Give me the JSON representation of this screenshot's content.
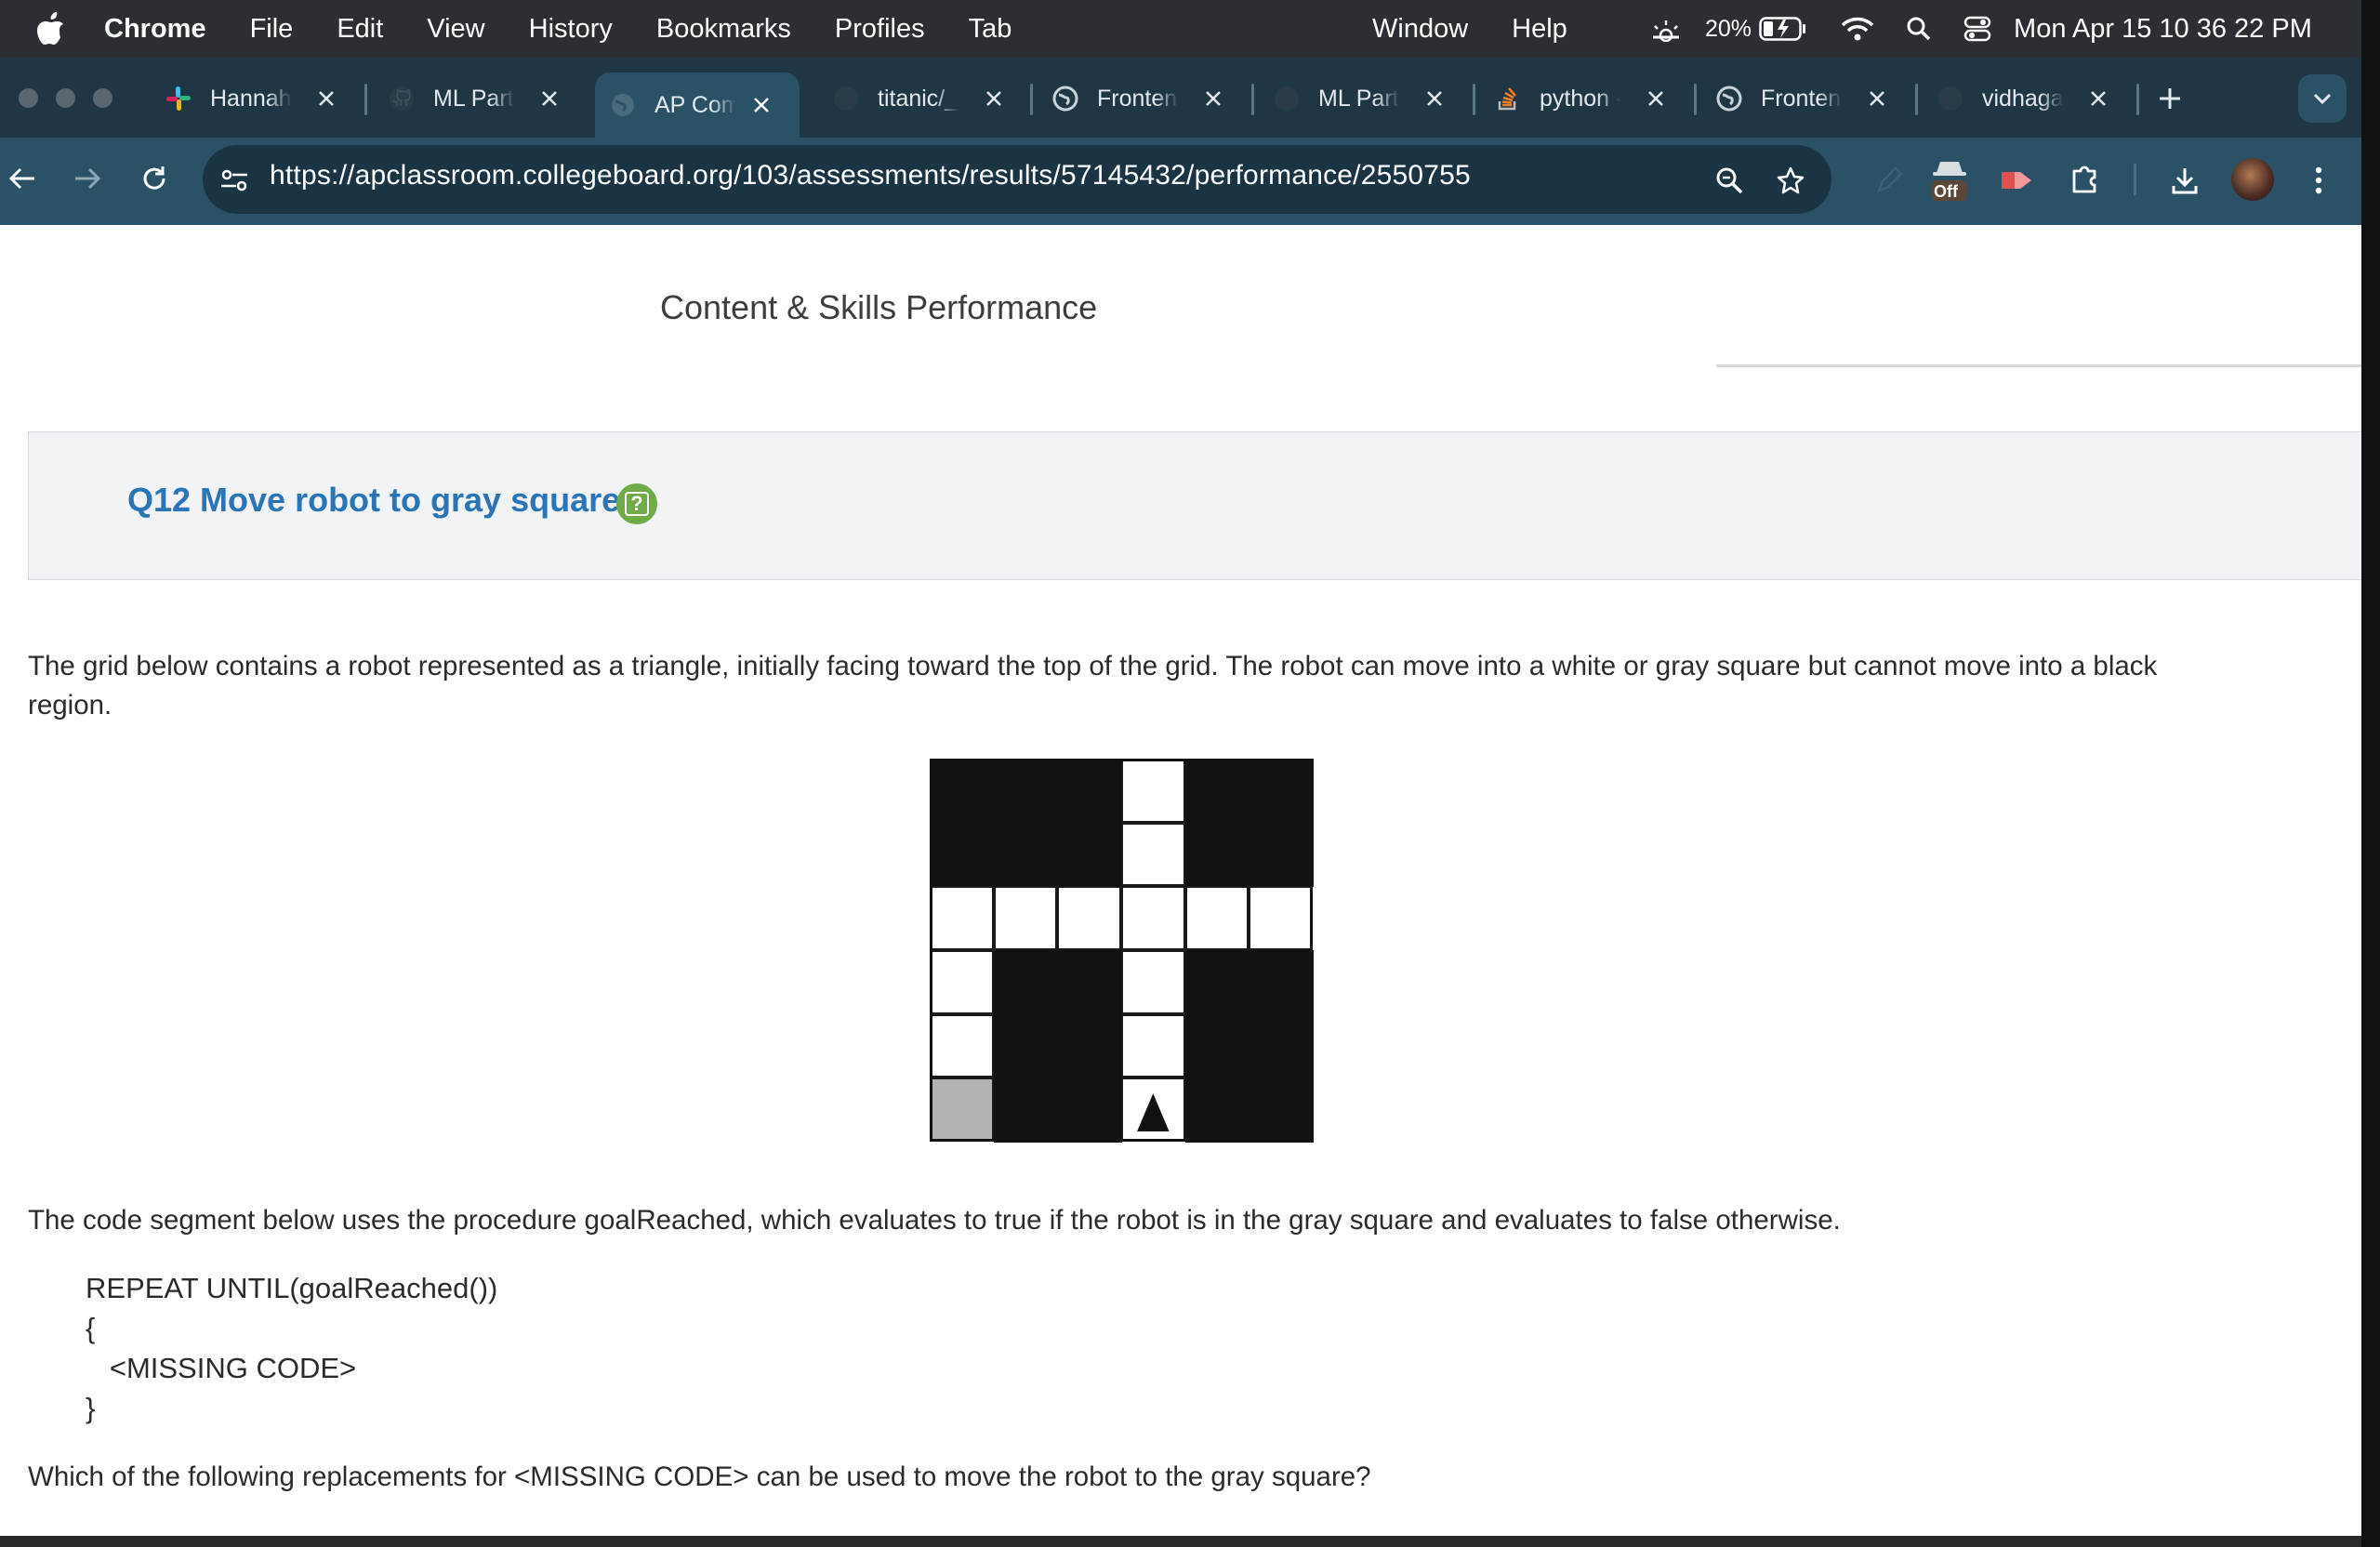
{
  "menubar": {
    "app_name": "Chrome",
    "items": [
      "File",
      "Edit",
      "View",
      "History",
      "Bookmarks",
      "Profiles",
      "Tab"
    ],
    "right_items": [
      "Window",
      "Help"
    ],
    "battery_percent": "20%",
    "clock": "Mon Apr 15  10 36 22 PM"
  },
  "tabs": [
    {
      "title": "Hannah I",
      "icon": "slack-icon"
    },
    {
      "title": "ML Part",
      "icon": "github-icon"
    },
    {
      "title": "AP Comp",
      "icon": "globe-icon",
      "active": true
    },
    {
      "title": "titanic/_",
      "icon": "github-icon"
    },
    {
      "title": "Frontend",
      "icon": "globe-icon"
    },
    {
      "title": "ML Part",
      "icon": "github-icon"
    },
    {
      "title": "python -",
      "icon": "stackoverflow-icon"
    },
    {
      "title": "Frontend",
      "icon": "globe-icon"
    },
    {
      "title": "vidhagar",
      "icon": "github-icon"
    }
  ],
  "toolbar": {
    "url": "https://apclassroom.collegeboard.org/103/assessments/results/57145432/performance/2550755",
    "extension_badge": "Off"
  },
  "page": {
    "section_heading": "Content & Skills Performance",
    "question_title": "Q12 Move robot to gray square",
    "help_symbol": "?",
    "intro": "The grid below contains a robot represented as a triangle, initially facing toward the top of the grid. The robot can move into a white or gray square but cannot move into a black region.",
    "goal_text": "The code segment below uses the procedure goalReached, which evaluates to true if the robot is in the gray square and evaluates to false otherwise.",
    "code_lines": [
      "REPEAT UNTIL(goalReached())",
      "{",
      "   <MISSING CODE>",
      "}"
    ],
    "final_question": "Which of the following replacements for <MISSING CODE> can be used to move the robot to the gray square?"
  },
  "grid": {
    "rows": 6,
    "cols": 6,
    "cells": [
      [
        "B",
        "B",
        "B",
        "W",
        "B",
        "B"
      ],
      [
        "B",
        "B",
        "B",
        "W",
        "B",
        "B"
      ],
      [
        "W",
        "W",
        "W",
        "W",
        "W",
        "W"
      ],
      [
        "W",
        "B",
        "B",
        "W",
        "B",
        "B"
      ],
      [
        "W",
        "B",
        "B",
        "W",
        "B",
        "B"
      ],
      [
        "G",
        "B",
        "B",
        "R",
        "B",
        "B"
      ]
    ],
    "robot": {
      "row": 5,
      "col": 3,
      "facing": "up"
    },
    "colors": {
      "white": "#ffffff",
      "black": "#111111",
      "gray": "#b3b3b3"
    }
  }
}
